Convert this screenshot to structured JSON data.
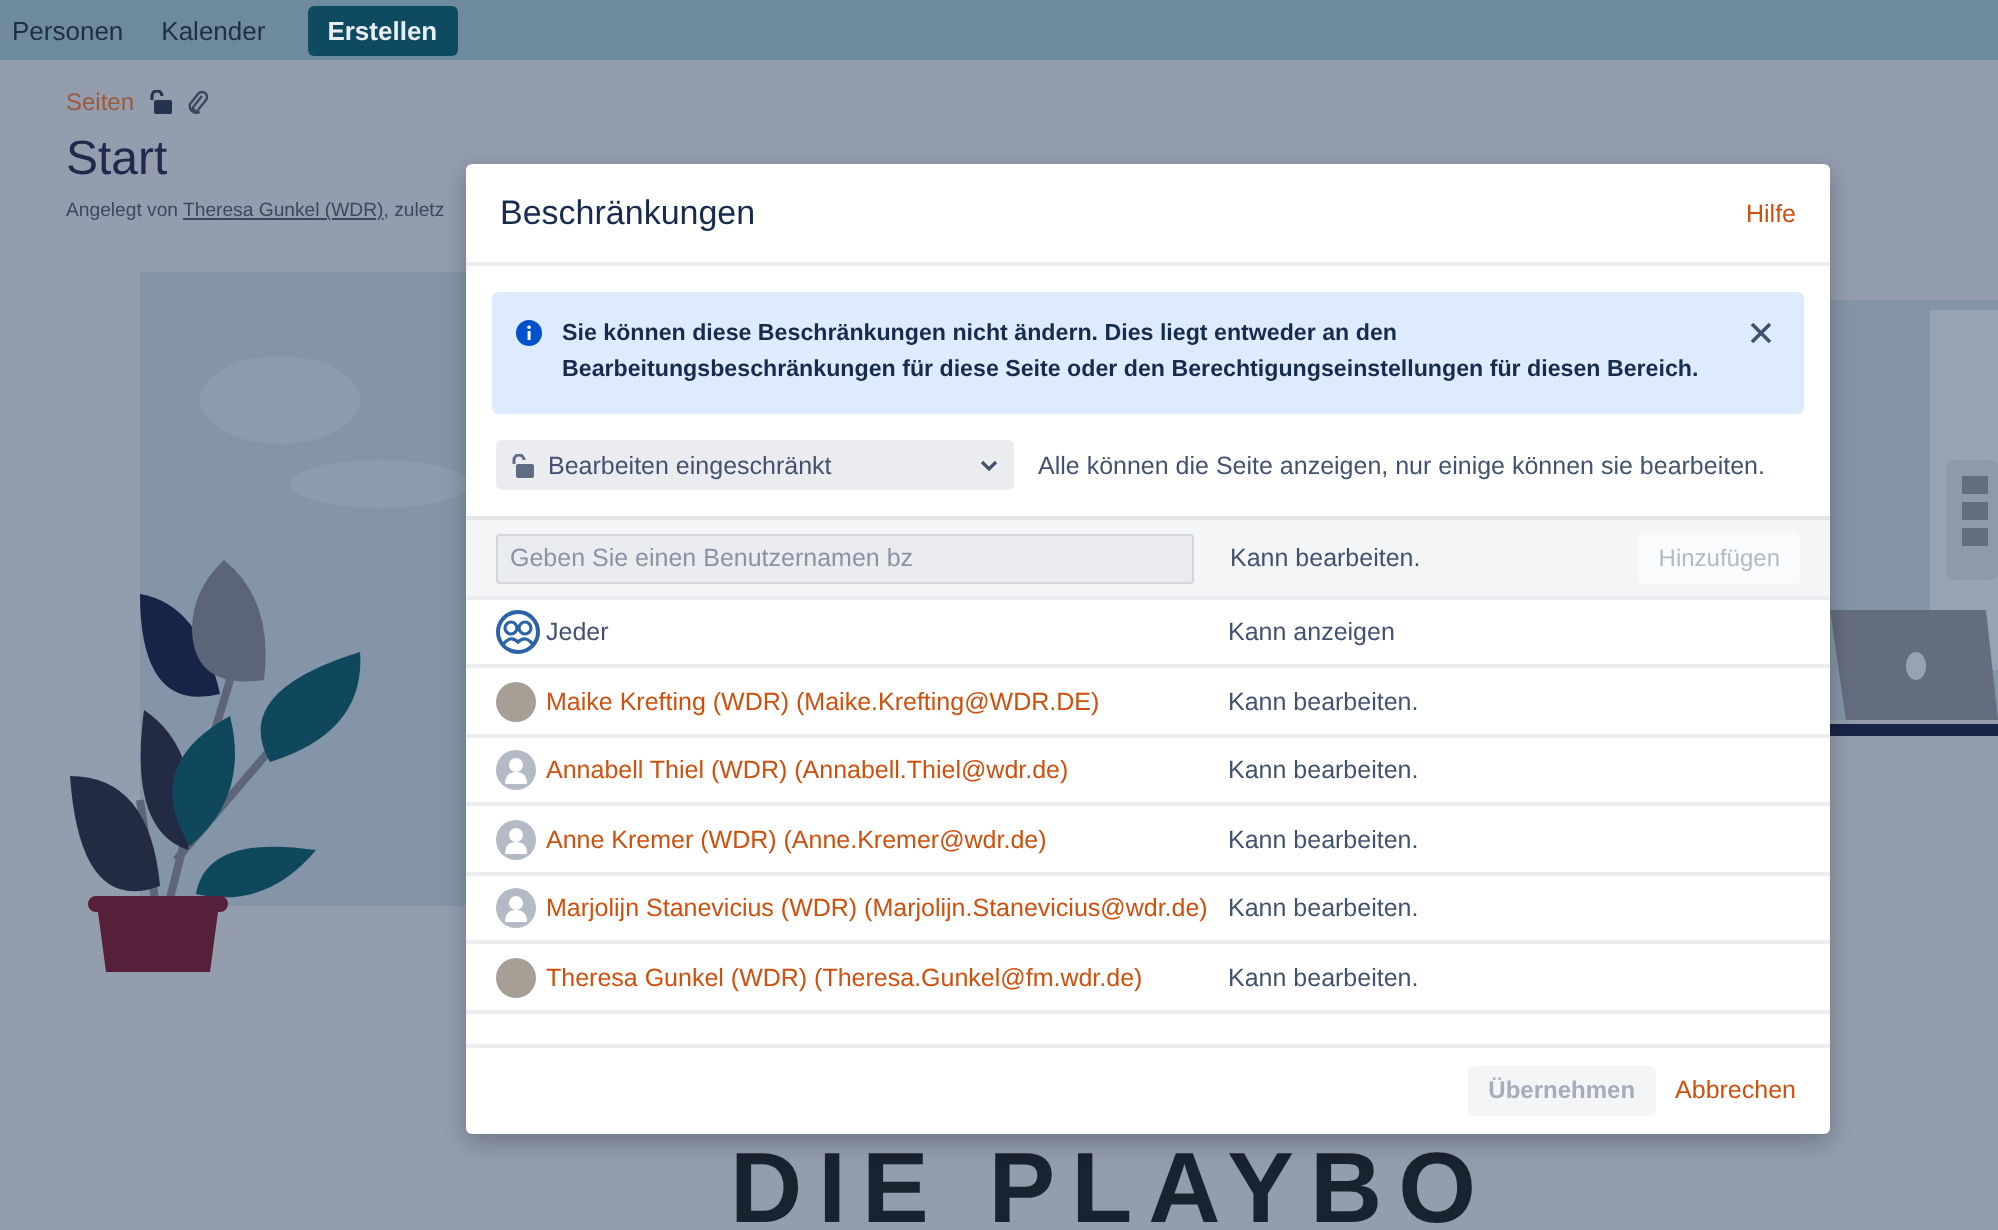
{
  "nav": {
    "items": [
      {
        "label": "Personen"
      },
      {
        "label": "Kalender"
      }
    ],
    "create_button": "Erstellen"
  },
  "page": {
    "breadcrumb": "Seiten",
    "title": "Start",
    "meta": {
      "prefix": "Angelegt von",
      "author": "Theresa Gunkel (WDR)",
      "suffix": ", zuletz"
    },
    "banner": "DIE PLAYBO"
  },
  "modal": {
    "title": "Beschränkungen",
    "help_link": "Hilfe",
    "alert": {
      "text": "Sie können diese Beschränkungen nicht ändern. Dies liegt entweder an den Bearbeitungsbeschränkungen für diese Seite oder den Berechtigungseinstellungen für diesen Bereich."
    },
    "restriction": {
      "value": "Bearbeiten eingeschränkt",
      "description": "Alle können die Seite anzeigen, nur einige können sie bearbeiten."
    },
    "add_row": {
      "placeholder": "Geben Sie einen Benutzernamen bz",
      "permission": "Kann bearbeiten.",
      "add_button": {
        "label": "Hinzufügen",
        "disabled": true
      }
    },
    "entries": [
      {
        "kind": "group",
        "name": "Jeder",
        "permission": "Kann anzeigen"
      },
      {
        "kind": "photo",
        "name": "Maike Krefting (WDR) (Maike.Krefting@WDR.DE)",
        "permission": "Kann bearbeiten."
      },
      {
        "kind": "default",
        "name": "Annabell Thiel (WDR) (Annabell.Thiel@wdr.de)",
        "permission": "Kann bearbeiten."
      },
      {
        "kind": "default",
        "name": "Anne Kremer (WDR) (Anne.Kremer@wdr.de)",
        "permission": "Kann bearbeiten."
      },
      {
        "kind": "default",
        "name": "Marjolijn Stanevicius (WDR) (Marjolijn.Stanevicius@wdr.de)",
        "permission": "Kann bearbeiten."
      },
      {
        "kind": "photo",
        "name": "Theresa Gunkel (WDR) (Theresa.Gunkel@fm.wdr.de)",
        "permission": "Kann bearbeiten."
      }
    ],
    "apply_button": {
      "label": "Übernehmen",
      "disabled": true
    },
    "cancel_link": "Abbrechen"
  }
}
